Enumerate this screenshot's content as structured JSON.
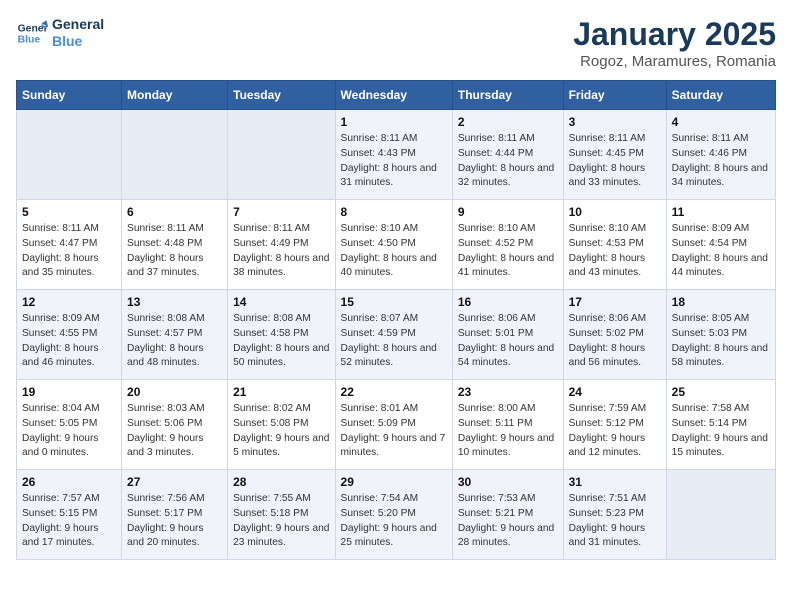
{
  "header": {
    "logo_line1": "General",
    "logo_line2": "Blue",
    "title": "January 2025",
    "subtitle": "Rogoz, Maramures, Romania"
  },
  "weekdays": [
    "Sunday",
    "Monday",
    "Tuesday",
    "Wednesday",
    "Thursday",
    "Friday",
    "Saturday"
  ],
  "weeks": [
    [
      {
        "day": "",
        "info": ""
      },
      {
        "day": "",
        "info": ""
      },
      {
        "day": "",
        "info": ""
      },
      {
        "day": "1",
        "info": "Sunrise: 8:11 AM\nSunset: 4:43 PM\nDaylight: 8 hours and 31 minutes."
      },
      {
        "day": "2",
        "info": "Sunrise: 8:11 AM\nSunset: 4:44 PM\nDaylight: 8 hours and 32 minutes."
      },
      {
        "day": "3",
        "info": "Sunrise: 8:11 AM\nSunset: 4:45 PM\nDaylight: 8 hours and 33 minutes."
      },
      {
        "day": "4",
        "info": "Sunrise: 8:11 AM\nSunset: 4:46 PM\nDaylight: 8 hours and 34 minutes."
      }
    ],
    [
      {
        "day": "5",
        "info": "Sunrise: 8:11 AM\nSunset: 4:47 PM\nDaylight: 8 hours and 35 minutes."
      },
      {
        "day": "6",
        "info": "Sunrise: 8:11 AM\nSunset: 4:48 PM\nDaylight: 8 hours and 37 minutes."
      },
      {
        "day": "7",
        "info": "Sunrise: 8:11 AM\nSunset: 4:49 PM\nDaylight: 8 hours and 38 minutes."
      },
      {
        "day": "8",
        "info": "Sunrise: 8:10 AM\nSunset: 4:50 PM\nDaylight: 8 hours and 40 minutes."
      },
      {
        "day": "9",
        "info": "Sunrise: 8:10 AM\nSunset: 4:52 PM\nDaylight: 8 hours and 41 minutes."
      },
      {
        "day": "10",
        "info": "Sunrise: 8:10 AM\nSunset: 4:53 PM\nDaylight: 8 hours and 43 minutes."
      },
      {
        "day": "11",
        "info": "Sunrise: 8:09 AM\nSunset: 4:54 PM\nDaylight: 8 hours and 44 minutes."
      }
    ],
    [
      {
        "day": "12",
        "info": "Sunrise: 8:09 AM\nSunset: 4:55 PM\nDaylight: 8 hours and 46 minutes."
      },
      {
        "day": "13",
        "info": "Sunrise: 8:08 AM\nSunset: 4:57 PM\nDaylight: 8 hours and 48 minutes."
      },
      {
        "day": "14",
        "info": "Sunrise: 8:08 AM\nSunset: 4:58 PM\nDaylight: 8 hours and 50 minutes."
      },
      {
        "day": "15",
        "info": "Sunrise: 8:07 AM\nSunset: 4:59 PM\nDaylight: 8 hours and 52 minutes."
      },
      {
        "day": "16",
        "info": "Sunrise: 8:06 AM\nSunset: 5:01 PM\nDaylight: 8 hours and 54 minutes."
      },
      {
        "day": "17",
        "info": "Sunrise: 8:06 AM\nSunset: 5:02 PM\nDaylight: 8 hours and 56 minutes."
      },
      {
        "day": "18",
        "info": "Sunrise: 8:05 AM\nSunset: 5:03 PM\nDaylight: 8 hours and 58 minutes."
      }
    ],
    [
      {
        "day": "19",
        "info": "Sunrise: 8:04 AM\nSunset: 5:05 PM\nDaylight: 9 hours and 0 minutes."
      },
      {
        "day": "20",
        "info": "Sunrise: 8:03 AM\nSunset: 5:06 PM\nDaylight: 9 hours and 3 minutes."
      },
      {
        "day": "21",
        "info": "Sunrise: 8:02 AM\nSunset: 5:08 PM\nDaylight: 9 hours and 5 minutes."
      },
      {
        "day": "22",
        "info": "Sunrise: 8:01 AM\nSunset: 5:09 PM\nDaylight: 9 hours and 7 minutes."
      },
      {
        "day": "23",
        "info": "Sunrise: 8:00 AM\nSunset: 5:11 PM\nDaylight: 9 hours and 10 minutes."
      },
      {
        "day": "24",
        "info": "Sunrise: 7:59 AM\nSunset: 5:12 PM\nDaylight: 9 hours and 12 minutes."
      },
      {
        "day": "25",
        "info": "Sunrise: 7:58 AM\nSunset: 5:14 PM\nDaylight: 9 hours and 15 minutes."
      }
    ],
    [
      {
        "day": "26",
        "info": "Sunrise: 7:57 AM\nSunset: 5:15 PM\nDaylight: 9 hours and 17 minutes."
      },
      {
        "day": "27",
        "info": "Sunrise: 7:56 AM\nSunset: 5:17 PM\nDaylight: 9 hours and 20 minutes."
      },
      {
        "day": "28",
        "info": "Sunrise: 7:55 AM\nSunset: 5:18 PM\nDaylight: 9 hours and 23 minutes."
      },
      {
        "day": "29",
        "info": "Sunrise: 7:54 AM\nSunset: 5:20 PM\nDaylight: 9 hours and 25 minutes."
      },
      {
        "day": "30",
        "info": "Sunrise: 7:53 AM\nSunset: 5:21 PM\nDaylight: 9 hours and 28 minutes."
      },
      {
        "day": "31",
        "info": "Sunrise: 7:51 AM\nSunset: 5:23 PM\nDaylight: 9 hours and 31 minutes."
      },
      {
        "day": "",
        "info": ""
      }
    ]
  ]
}
